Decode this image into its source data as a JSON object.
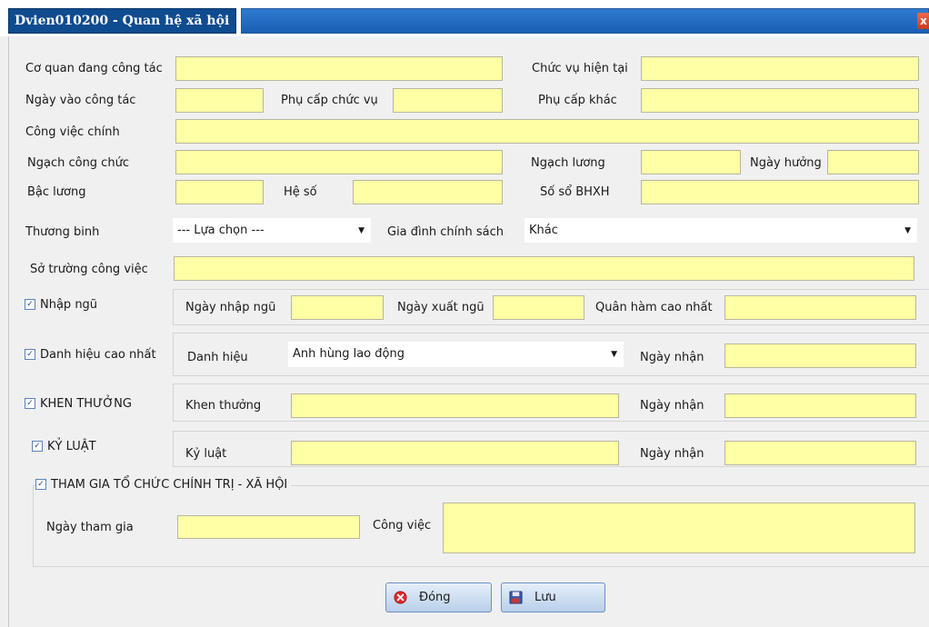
{
  "window": {
    "title": "Dvien010200 - Quan hệ xã hội",
    "close_glyph": "x"
  },
  "fields": {
    "co_quan": "Cơ quan đang công tác",
    "chuc_vu": "Chức vụ hiện tại",
    "ngay_vao": "Ngày vào công tác",
    "phu_cap_chuc_vu": "Phụ cấp chức vụ",
    "phu_cap_khac": "Phụ cấp khác",
    "cong_viec_chinh": "Công việc chính",
    "ngach_cong_chuc": "Ngạch công chức",
    "ngach_luong": "Ngạch lương",
    "ngay_huong": "Ngày hưởng",
    "bac_luong": "Bậc lương",
    "he_so": "Hệ số",
    "so_bhxh": "Số sổ BHXH",
    "thuong_binh": "Thương binh",
    "thuong_binh_value": "--- Lựa chọn ---",
    "gia_dinh": "Gia đình chính sách",
    "gia_dinh_value": "Khác",
    "so_truong": "Sở trường công việc"
  },
  "nhap_ngu": {
    "label": "Nhập ngũ",
    "checked": true,
    "ngay_nhap": "Ngày nhập ngũ",
    "ngay_xuat": "Ngày xuất ngũ",
    "quan_ham": "Quân hàm cao nhất"
  },
  "danh_hieu": {
    "label": "Danh hiệu cao nhất",
    "checked": true,
    "danh_hieu": "Danh hiệu",
    "danh_hieu_value": "Anh hùng lao động",
    "ngay_nhan": "Ngày nhận"
  },
  "khen_thuong": {
    "label": "KHEN THƯỞNG",
    "checked": true,
    "khen_thuong": "Khen thưởng",
    "ngay_nhan": "Ngày nhận"
  },
  "ky_luat": {
    "label": "KỶ LUẬT",
    "checked": true,
    "ky_luat": "Kỷ luật",
    "ngay_nhan": "Ngày nhận"
  },
  "tham_gia": {
    "label": "THAM GIA TỔ CHỨC CHÍNH TRỊ - XÃ HỘI",
    "checked": true,
    "ngay_tham_gia": "Ngày tham gia",
    "cong_viec": "Công việc"
  },
  "buttons": {
    "dong": "Đóng",
    "luu": "Lưu"
  },
  "colors": {
    "field_yellow": "#ffffa6",
    "title_blue": "#0f4b8f",
    "close_red": "#d9482a"
  }
}
